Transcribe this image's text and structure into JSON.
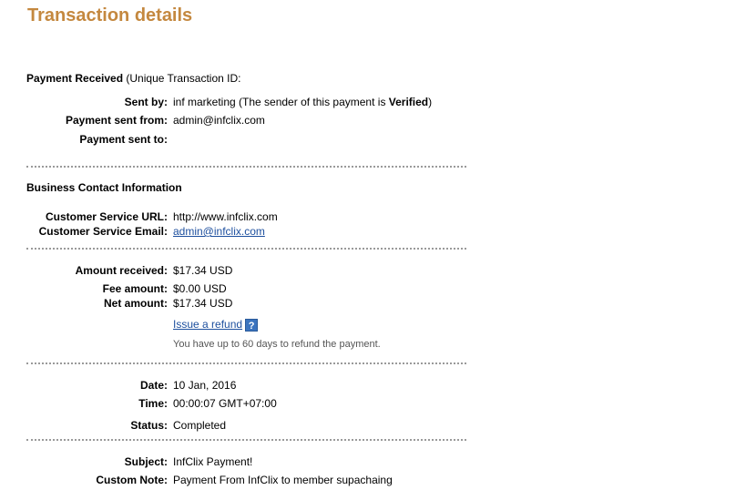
{
  "page": {
    "title": "Transaction details"
  },
  "payment": {
    "heading_bold": "Payment Received",
    "heading_rest": " (Unique Transaction ID:",
    "sent_by_label": "Sent by:",
    "sent_by_value": "inf marketing (The sender of this payment is ",
    "sent_by_status": "Verified",
    "sent_by_close": ")",
    "sent_from_label": "Payment sent from:",
    "sent_from_value": "admin@infclix.com",
    "sent_to_label": "Payment sent to:",
    "sent_to_value": ""
  },
  "business": {
    "heading": "Business Contact Information",
    "url_label": "Customer Service URL:",
    "url_value": "http://www.infclix.com",
    "email_label": "Customer Service Email:",
    "email_value": "admin@infclix.com"
  },
  "amounts": {
    "received_label": "Amount received:",
    "received_value": "$17.34 USD",
    "fee_label": "Fee amount:",
    "fee_value": "$0.00 USD",
    "net_label": "Net amount:",
    "net_value": "$17.34 USD",
    "refund_link": "Issue a refund",
    "help_icon_glyph": "?",
    "refund_note": "You have up to 60 days to refund the payment."
  },
  "timing": {
    "date_label": "Date:",
    "date_value": "10 Jan, 2016",
    "time_label": "Time:",
    "time_value": "00:00:07 GMT+07:00",
    "status_label": "Status:",
    "status_value": "Completed"
  },
  "details": {
    "subject_label": "Subject:",
    "subject_value": "InfClix Payment!",
    "note_label": "Custom Note:",
    "note_value": "Payment From InfClix to member supachaing"
  },
  "colors": {
    "title": "#c4883f",
    "link": "#1d4f9e",
    "divider": "#9a9a9a",
    "help_icon": "#3b74bf"
  }
}
